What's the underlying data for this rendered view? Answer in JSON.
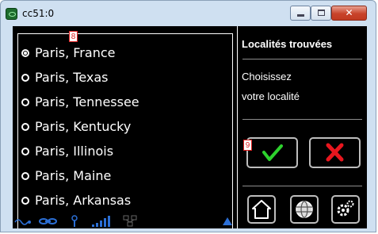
{
  "window": {
    "title": "cc51:0",
    "controls": {
      "minimize": "minimize-icon",
      "maximize": "maximize-icon",
      "close": "close-icon"
    }
  },
  "list": {
    "marker": "8",
    "items": [
      {
        "label": "Paris, France",
        "selected": true
      },
      {
        "label": "Paris, Texas",
        "selected": false
      },
      {
        "label": "Paris, Tennessee",
        "selected": false
      },
      {
        "label": "Paris, Kentucky",
        "selected": false
      },
      {
        "label": "Paris, Illinois",
        "selected": false
      },
      {
        "label": "Paris, Maine",
        "selected": false
      },
      {
        "label": "Paris, Arkansas",
        "selected": false
      }
    ]
  },
  "panel": {
    "title": "Localités trouvées",
    "instruction_line1": "Choisissez",
    "instruction_line2": "votre localité",
    "ok_marker": "9"
  },
  "buttons": {
    "ok": "check-icon",
    "cancel": "x-icon",
    "home": "home-icon",
    "globe": "globe-icon",
    "settings": "gear-icon"
  },
  "status_icons": [
    "wifi-connection-icon",
    "link-icon",
    "antenna-icon",
    "signal-bars-icon",
    "network-icon",
    "triangle-up-icon"
  ],
  "colors": {
    "ok": "#2dd12d",
    "cancel": "#e8161e",
    "status_blue": "#2b6fd6"
  }
}
